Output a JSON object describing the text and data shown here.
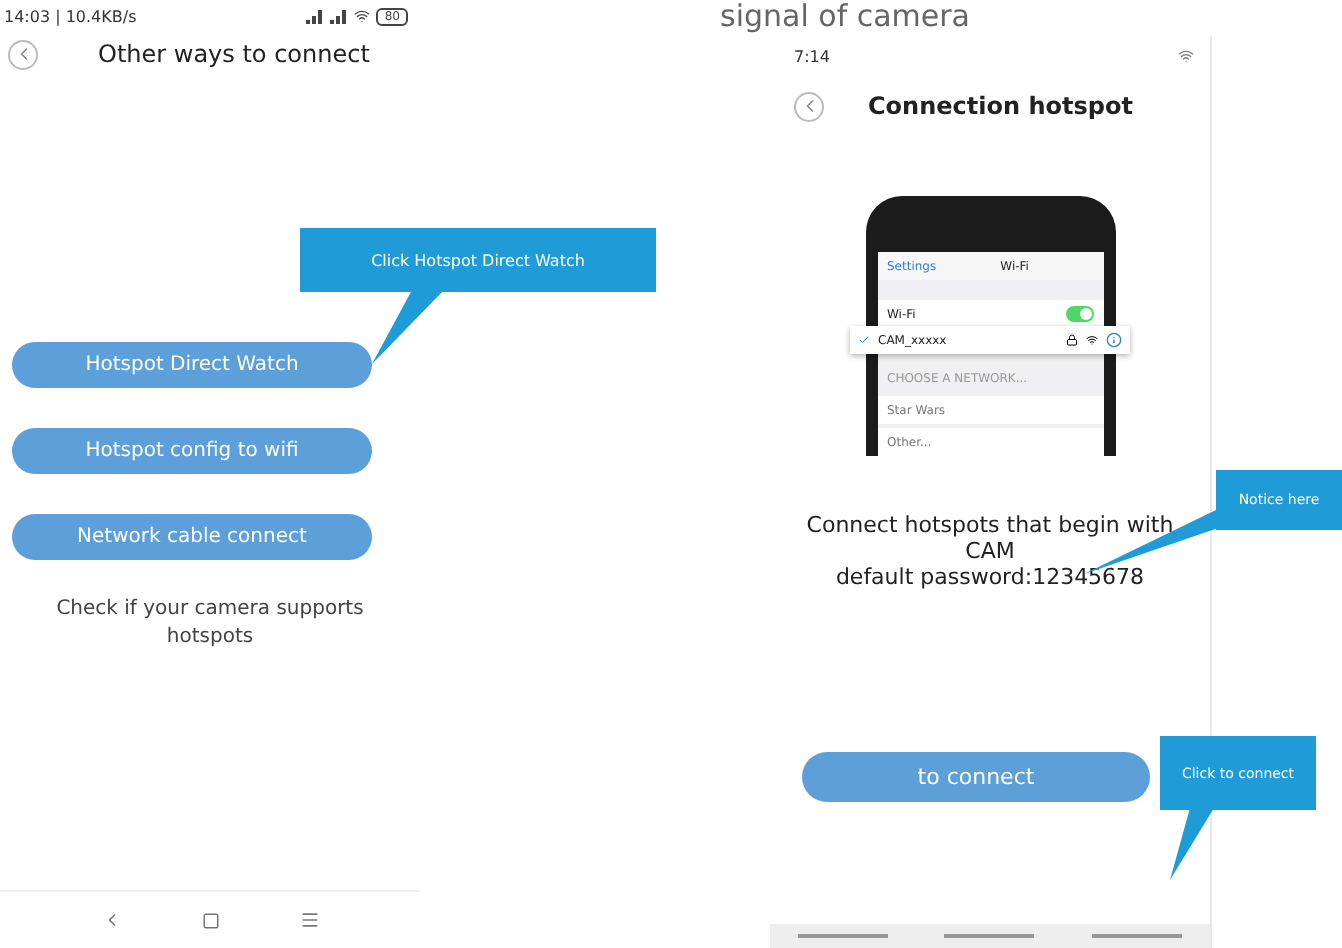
{
  "left_screen": {
    "status": "14:03 | 10.4KB/s",
    "battery": "80",
    "title": "Other ways to connect",
    "buttons": [
      {
        "label": "Hotspot Direct Watch"
      },
      {
        "label": "Hotspot config to wifi"
      },
      {
        "label": "Network cable connect"
      }
    ],
    "note": "Check if your camera supports hotspots"
  },
  "heading": "signal of camera",
  "right_screen": {
    "status": "7:14",
    "title": "Connection hotspot",
    "illustration": {
      "back": "Settings",
      "header": "Wi-Fi",
      "wifi_label": "Wi-Fi",
      "wifi_on": true,
      "network": "CAM_xxxxx",
      "section": "CHOOSE A NETWORK...",
      "others": [
        "Star Wars",
        "Other..."
      ]
    },
    "message": [
      "Connect hotspots that begin with",
      "CAM",
      "default password:12345678"
    ],
    "button": "to connect"
  },
  "callouts": [
    {
      "text": "Click Hotspot Direct Watch"
    },
    {
      "text": "Notice here"
    },
    {
      "text": "Click to connect"
    }
  ]
}
